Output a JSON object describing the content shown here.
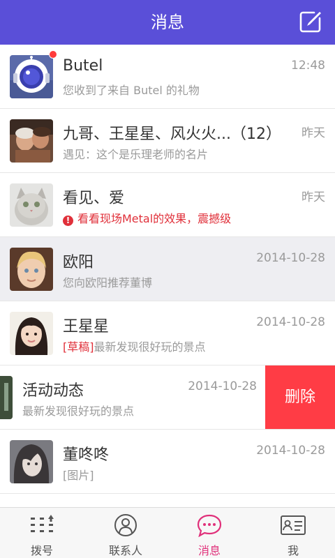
{
  "header": {
    "title": "消息",
    "compose_icon": "compose-icon"
  },
  "conversations": [
    {
      "name": "Butel",
      "time": "12:48",
      "preview": "您收到了来自 Butel 的礼物",
      "unread_dot": true
    },
    {
      "name": "九哥、王星星、风火火...（12）",
      "time": "昨天",
      "preview": "遇见：这个是乐理老师的名片"
    },
    {
      "name": "看见、爱",
      "time": "昨天",
      "preview": "看看现场Metal的效果，震撼级",
      "alert": true
    },
    {
      "name": "欧阳",
      "time": "2014-10-28",
      "preview": "您向欧阳推荐董博",
      "selected": true
    },
    {
      "name": "王星星",
      "time": "2014-10-28",
      "draft_tag": "[草稿]",
      "preview": "最新发现很好玩的景点"
    },
    {
      "name": "活动动态",
      "time": "2014-10-28",
      "preview": "最新发现很好玩的景点",
      "swiped": true,
      "delete_label": "删除"
    },
    {
      "name": "董咚咚",
      "time": "2014-10-28",
      "preview": "[图片]"
    }
  ],
  "tabbar": {
    "tabs": [
      {
        "label": "拨号",
        "icon": "dialpad-icon"
      },
      {
        "label": "联系人",
        "icon": "contacts-icon"
      },
      {
        "label": "消息",
        "icon": "message-icon",
        "active": true
      },
      {
        "label": "我",
        "icon": "profile-card-icon"
      }
    ]
  },
  "colors": {
    "header": "#5a4fd8",
    "accent": "#e0307a",
    "delete": "#ff3c45",
    "alert": "#e0303a"
  }
}
